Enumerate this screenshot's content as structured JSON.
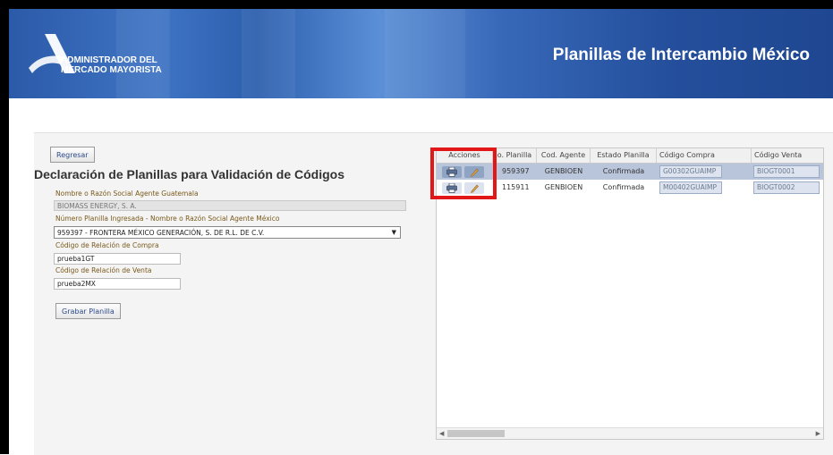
{
  "header": {
    "org_line1": "ADMINISTRADOR DEL",
    "org_line2": "MERCADO MAYORISTA",
    "title": "Planillas de Intercambio México"
  },
  "form": {
    "back_label": "Regresar",
    "title": "Declaración de Planillas para Validación de Códigos",
    "agent_gt_label": "Nombre o Razón Social Agente Guatemala",
    "agent_gt_value": "BIOMASS ENERGY, S. A.",
    "planilla_label": "Número Planilla Ingresada - Nombre o Razón Social Agente México",
    "planilla_value": "959397 - FRONTERA MÉXICO GENERACIÓN, S. DE R.L. DE C.V.",
    "compra_label": "Código de Relación de Compra",
    "compra_value": "prueba1GT",
    "venta_label": "Código de Relación de Venta",
    "venta_value": "prueba2MX",
    "save_label": "Grabar Planilla"
  },
  "grid": {
    "columns": [
      "Acciones",
      "o. Planilla",
      "Cod. Agente",
      "Estado Planilla",
      "Código Compra",
      "Código Venta"
    ],
    "rows": [
      {
        "planilla": "959397",
        "agente": "GENBIOEN",
        "estado": "Confirmada",
        "compra": "G00302GUAIMP",
        "venta": "BIOGT0001"
      },
      {
        "planilla": "115911",
        "agente": "GENBIOEN",
        "estado": "Confirmada",
        "compra": "M00402GUAIMP",
        "venta": "BIOGT0002"
      }
    ]
  },
  "colors": {
    "banner": "#2b5aa8",
    "highlight": "#e21818",
    "label": "#7a5a1a",
    "selected_row": "#b9c5da"
  },
  "icons": {
    "print": "printer-icon",
    "edit": "pencil-icon"
  }
}
